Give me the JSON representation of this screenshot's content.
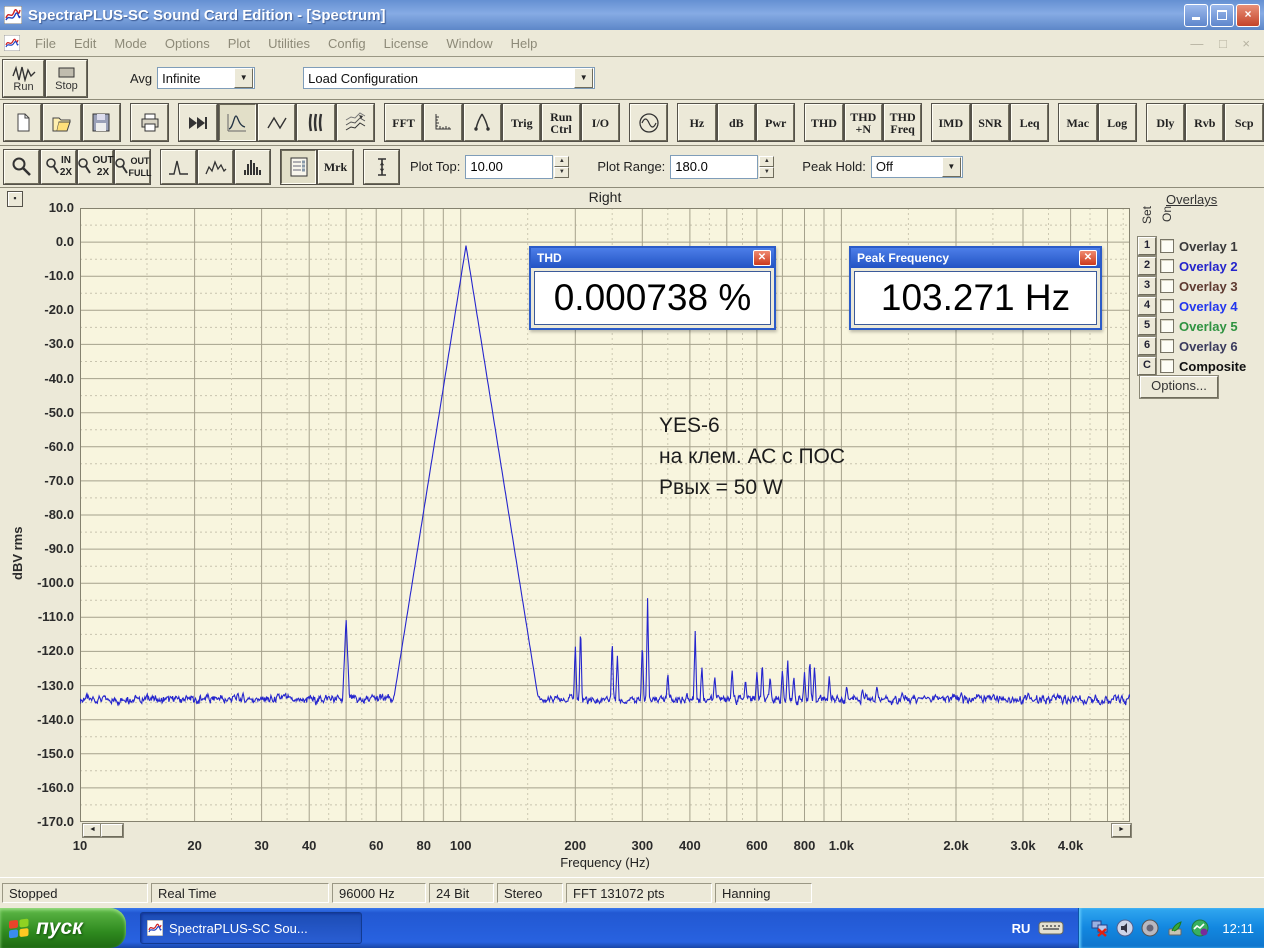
{
  "window": {
    "title": "SpectraPLUS-SC Sound Card Edition - [Spectrum]"
  },
  "menu": {
    "items": [
      "File",
      "Edit",
      "Mode",
      "Options",
      "Plot",
      "Utilities",
      "Config",
      "License",
      "Window",
      "Help"
    ]
  },
  "toolbar1": {
    "run": "Run",
    "stop": "Stop",
    "avg_label": "Avg",
    "avg_value": "Infinite",
    "load_config_value": "Load Configuration"
  },
  "toolbar2": {
    "fft": "FFT",
    "trig": "Trig",
    "runctrl": "Run\nCtrl",
    "io": "I/O",
    "hz": "Hz",
    "db": "dB",
    "pwr": "Pwr",
    "thd": "THD",
    "thdn": "THD\n+N",
    "thdfreq": "THD\nFreq",
    "imd": "IMD",
    "snr": "SNR",
    "leq": "Leq",
    "mac": "Mac",
    "log": "Log",
    "dly": "Dly",
    "rvb": "Rvb",
    "scp": "Scp"
  },
  "toolbar3": {
    "in2x": "IN\n2X",
    "out2x": "OUT\n2X",
    "outfull": "OUT\nFULL",
    "mrk": "Mrk",
    "plot_top_label": "Plot Top:",
    "plot_top_value": "10.00",
    "plot_range_label": "Plot Range:",
    "plot_range_value": "180.0",
    "peak_hold_label": "Peak Hold:",
    "peak_hold_value": "Off"
  },
  "plot": {
    "title": "Right",
    "ylabel": "dBV rms",
    "xlabel": "Frequency (Hz)",
    "logo": "S+",
    "annotation": "YES-6\nна клем. АС с ПОС\nРвых = 50 W"
  },
  "thd_window": {
    "title": "THD",
    "value": "0.000738 %"
  },
  "peak_window": {
    "title": "Peak Frequency",
    "value": "103.271 Hz"
  },
  "overlays": {
    "header": "Overlays",
    "set_label": "Set",
    "on_label": "On",
    "options": "Options...",
    "items": [
      {
        "key": "1",
        "label": "Overlay 1",
        "color": "#3a3a3a"
      },
      {
        "key": "2",
        "label": "Overlay 2",
        "color": "#2424cc"
      },
      {
        "key": "3",
        "label": "Overlay 3",
        "color": "#5e3a30"
      },
      {
        "key": "4",
        "label": "Overlay 4",
        "color": "#2236ee"
      },
      {
        "key": "5",
        "label": "Overlay 5",
        "color": "#2f9340"
      },
      {
        "key": "6",
        "label": "Overlay 6",
        "color": "#3a3a5e"
      },
      {
        "key": "C",
        "label": "Composite",
        "color": "#111111"
      }
    ]
  },
  "statusbar": {
    "items": [
      "Stopped",
      "Real Time",
      "96000 Hz",
      "24 Bit",
      "Stereo",
      "FFT 131072 pts",
      "Hanning"
    ]
  },
  "taskbar": {
    "start": "пуск",
    "task": "SpectraPLUS-SC Sou...",
    "lang": "RU",
    "time": "12:11"
  },
  "chart_data": {
    "type": "line",
    "title": "Right",
    "xlabel": "Frequency (Hz)",
    "ylabel": "dBV rms",
    "x_scale": "log",
    "x_range": [
      10,
      5730
    ],
    "ylim": [
      -170,
      10
    ],
    "y_tick_step": 10,
    "x_ticks": [
      10,
      20,
      30,
      40,
      60,
      80,
      100,
      200,
      300,
      400,
      600,
      800,
      1000,
      2000,
      3000,
      4000
    ],
    "x_tick_labels": [
      "10",
      "20",
      "30",
      "40",
      "60",
      "80",
      "100",
      "200",
      "300",
      "400",
      "600",
      "800",
      "1.0k",
      "2.0k",
      "3.0k",
      "4.0k"
    ],
    "grid": true,
    "line_color": "#2525cd",
    "noise_floor_db": -134,
    "main_peak": {
      "freq": 103.271,
      "db": -1,
      "skirt_slope": 700
    },
    "spikes": [
      [
        50,
        -110
      ],
      [
        150,
        -122
      ],
      [
        200,
        -118
      ],
      [
        206.5,
        -112
      ],
      [
        250,
        -116
      ],
      [
        258,
        -121
      ],
      [
        300,
        -117
      ],
      [
        309.8,
        -104
      ],
      [
        350,
        -126
      ],
      [
        413,
        -114
      ],
      [
        430,
        -124
      ],
      [
        465,
        -127
      ],
      [
        516.4,
        -125
      ],
      [
        560,
        -128
      ],
      [
        600,
        -126
      ],
      [
        619.6,
        -123
      ],
      [
        650,
        -127
      ],
      [
        700,
        -125
      ],
      [
        722.9,
        -122
      ],
      [
        750,
        -127
      ],
      [
        800,
        -126
      ],
      [
        826.2,
        -122
      ],
      [
        850,
        -124
      ],
      [
        929.4,
        -127
      ],
      [
        1032.7,
        -130
      ],
      [
        1136,
        -131
      ],
      [
        1240,
        -130
      ],
      [
        1445,
        -132
      ],
      [
        1652,
        -133
      ],
      [
        2066,
        -132
      ],
      [
        2500,
        -133
      ],
      [
        3098,
        -132
      ],
      [
        4130,
        -133
      ]
    ],
    "readouts": {
      "thd_percent": "0.000738 %",
      "peak_frequency_hz": "103.271 Hz"
    }
  }
}
